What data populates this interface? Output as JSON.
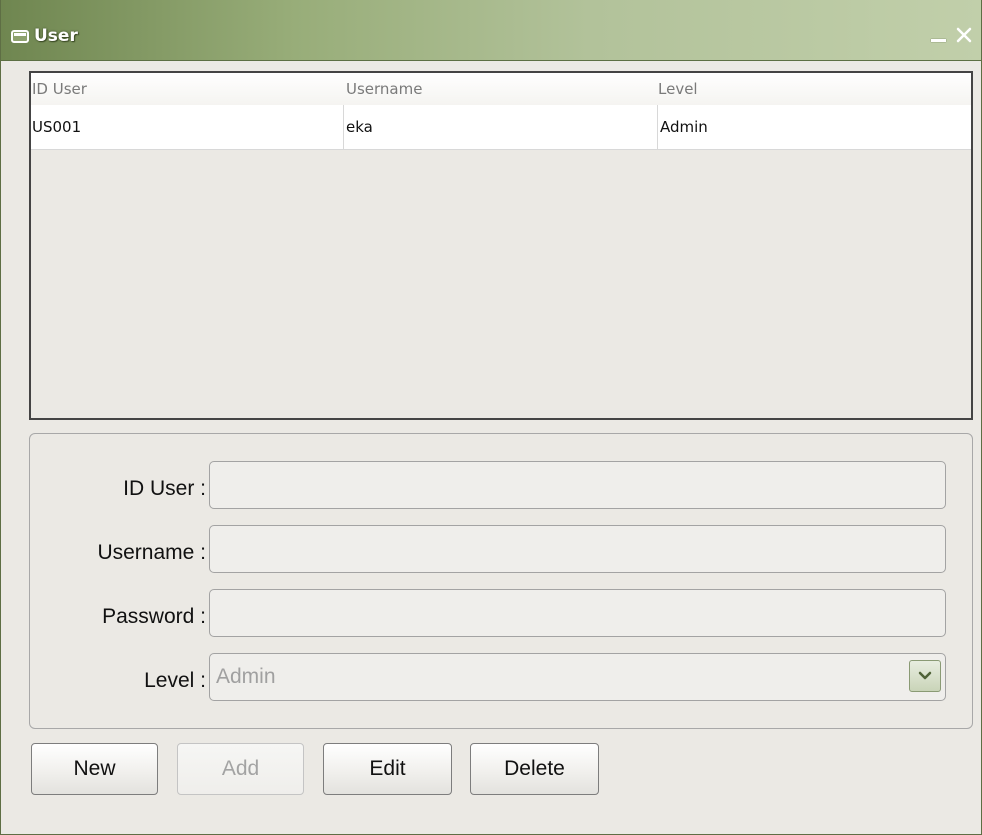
{
  "window": {
    "title": "User",
    "accent_color": "#8ea26d"
  },
  "grid": {
    "columns": [
      "ID User",
      "Username",
      "Level"
    ],
    "rows": [
      [
        "US001",
        "eka",
        "Admin"
      ]
    ]
  },
  "form": {
    "id_user_label": "ID User :",
    "id_user_value": "",
    "username_label": "Username :",
    "username_value": "",
    "password_label": "Password :",
    "password_value": "",
    "level_label": "Level :",
    "level_selected": "Admin"
  },
  "buttons": {
    "new": "New",
    "add": "Add",
    "edit": "Edit",
    "delete": "Delete"
  }
}
